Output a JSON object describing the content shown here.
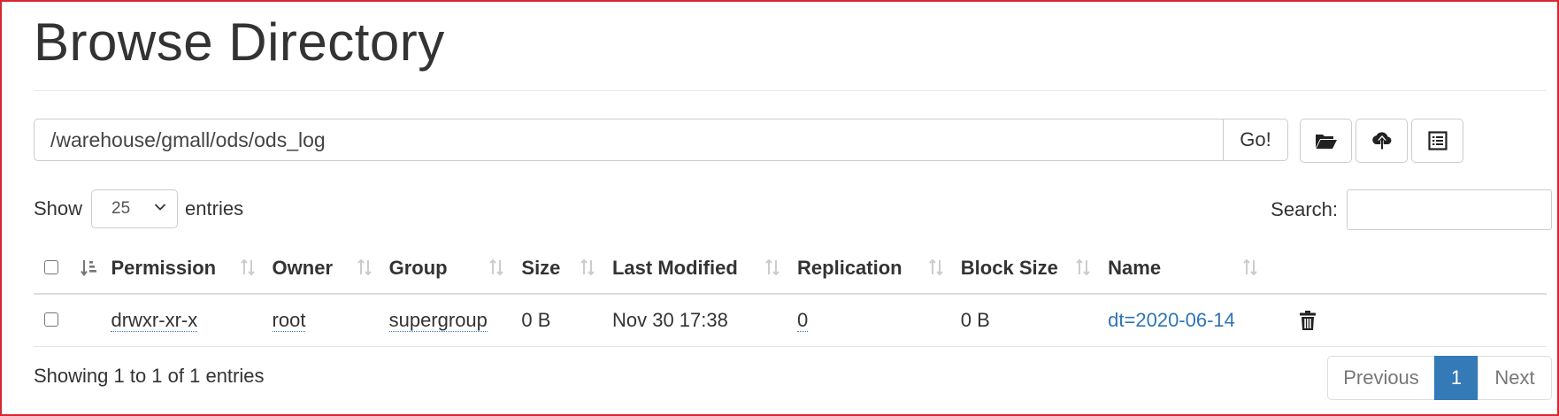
{
  "page": {
    "title": "Browse Directory"
  },
  "pathbar": {
    "value": "/warehouse/gmall/ods/ods_log",
    "go_label": "Go!"
  },
  "toolbar": {
    "icons": [
      "folder-open-icon",
      "cloud-upload-icon",
      "list-alt-icon"
    ]
  },
  "length": {
    "show_label": "Show",
    "selected": "25",
    "entries_label": "entries"
  },
  "search": {
    "label": "Search:",
    "value": ""
  },
  "table": {
    "columns": [
      "Permission",
      "Owner",
      "Group",
      "Size",
      "Last Modified",
      "Replication",
      "Block Size",
      "Name"
    ],
    "rows": [
      {
        "permission": "drwxr-xr-x",
        "owner": "root",
        "group": "supergroup",
        "size": "0 B",
        "last_modified": "Nov 30 17:38",
        "replication": "0",
        "block_size": "0 B",
        "name": "dt=2020-06-14"
      }
    ]
  },
  "footer": {
    "info": "Showing 1 to 1 of 1 entries"
  },
  "pagination": {
    "previous": "Previous",
    "current": "1",
    "next": "Next"
  }
}
